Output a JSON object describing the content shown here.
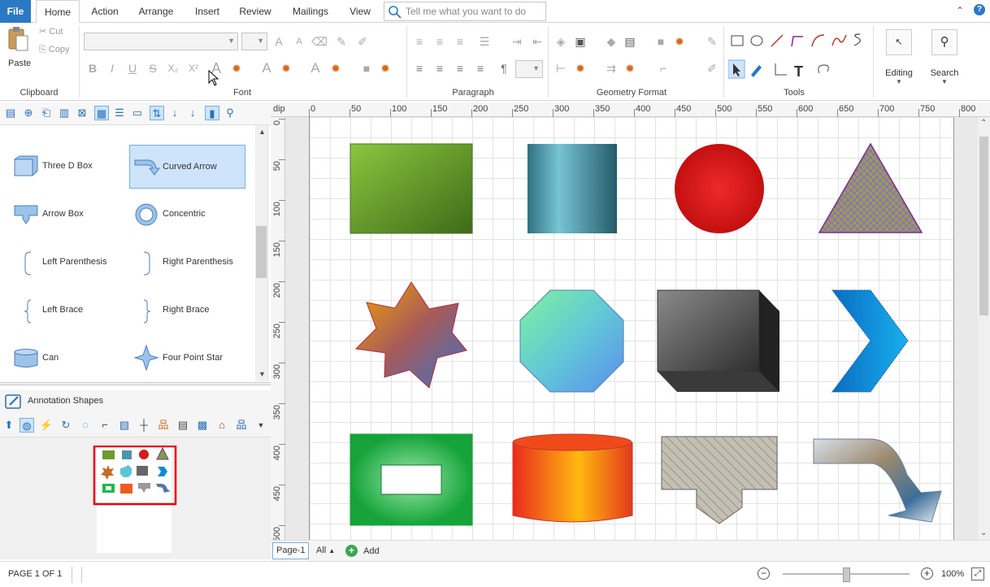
{
  "tabs": {
    "file": "File",
    "home": "Home",
    "action": "Action",
    "arrange": "Arrange",
    "insert": "Insert",
    "review": "Review",
    "mailings": "Mailings",
    "view": "View"
  },
  "tellme": {
    "placeholder": "Tell me what you want to do"
  },
  "clipboard": {
    "paste": "Paste",
    "cut": "Cut",
    "copy": "Copy",
    "label": "Clipboard"
  },
  "groups": {
    "font": "Font",
    "paragraph": "Paragraph",
    "geometry": "Geometry Format",
    "tools": "Tools"
  },
  "editing": {
    "editing": "Editing",
    "search": "Search"
  },
  "shapes": {
    "items": [
      {
        "label": "Three D Box"
      },
      {
        "label": "Curved Arrow"
      },
      {
        "label": "Arrow Box"
      },
      {
        "label": "Concentric"
      },
      {
        "label": "Left Parenthesis"
      },
      {
        "label": "Right Parenthesis"
      },
      {
        "label": "Left Brace"
      },
      {
        "label": "Right Brace"
      },
      {
        "label": "Can"
      },
      {
        "label": "Four Point Star"
      }
    ]
  },
  "annotation": {
    "title": "Annotation Shapes"
  },
  "ruler": {
    "unit": "dip",
    "top": [
      "0",
      "50",
      "100",
      "150",
      "200",
      "250",
      "300",
      "350",
      "400",
      "450",
      "500",
      "550",
      "600",
      "650",
      "700",
      "750",
      "800"
    ],
    "left": [
      "0",
      "50",
      "100",
      "150",
      "200",
      "250",
      "300",
      "350",
      "400",
      "450",
      "500"
    ]
  },
  "pages": {
    "current": "Page-1",
    "all": "All",
    "add": "Add"
  },
  "status": {
    "page": "PAGE 1 OF 1",
    "zoom": "100%",
    "zoom_level": 0.5
  },
  "colors": {
    "accent": "#2b78c5",
    "selection": "#cde4fb"
  }
}
